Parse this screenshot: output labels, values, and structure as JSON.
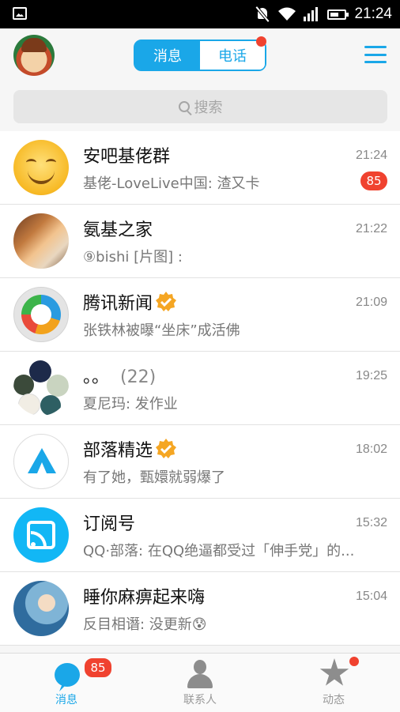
{
  "status_bar": {
    "time": "21:24"
  },
  "header": {
    "tabs": [
      {
        "label": "消息",
        "active": true
      },
      {
        "label": "电话",
        "active": false,
        "has_dot": true
      }
    ]
  },
  "search": {
    "placeholder": "搜索"
  },
  "conversations": [
    {
      "name": "安吧基佬群",
      "preview": "基佬-LoveLive中国: 渣又卡",
      "time": "21:24",
      "badge": "85"
    },
    {
      "name": "氨基之家",
      "preview": "⑨bishi [片图] :",
      "time": "21:22"
    },
    {
      "name": "腾讯新闻",
      "preview": "张铁林被曝“坐床”成活佛",
      "time": "21:09",
      "verified": true
    },
    {
      "name": "。。",
      "count": "(22)",
      "preview": "夏尼玛: 发作业",
      "time": "19:25"
    },
    {
      "name": "部落精选",
      "preview": "有了她，甄嬛就弱爆了",
      "time": "18:02",
      "verified": true
    },
    {
      "name": "订阅号",
      "preview": "QQ·部落: 在QQ绝逼都受过「伸手党」的...",
      "time": "15:32"
    },
    {
      "name": "睡你麻痹起来嗨",
      "preview": "反目相谮: 没更新😰",
      "time": "15:04"
    }
  ],
  "bottom_nav": [
    {
      "label": "消息",
      "badge": "85",
      "active": true
    },
    {
      "label": "联系人"
    },
    {
      "label": "动态",
      "has_dot": true
    }
  ],
  "colors": {
    "accent": "#1aa7e8",
    "badge": "#f0422f"
  }
}
